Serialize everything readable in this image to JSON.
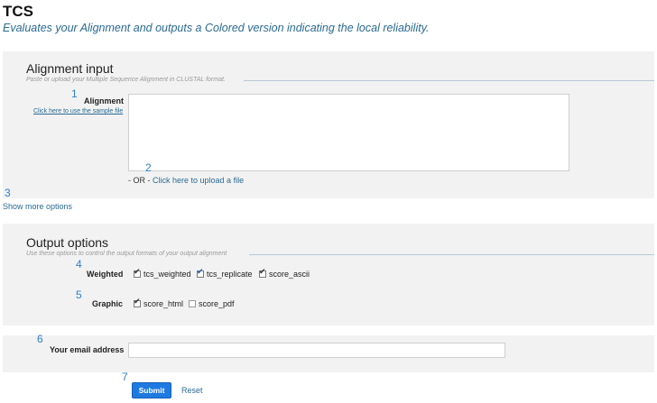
{
  "page": {
    "title": "TCS",
    "subtitle": "Evaluates your Alignment and outputs a Colored version indicating the local reliability."
  },
  "alignment_input": {
    "title": "Alignment input",
    "description": "Paste or upload your Multiple Sequence Alignment in CLUSTAL format.",
    "label": "Alignment",
    "sample_link": "Click here to use the sample file",
    "textarea_value": "",
    "or_text": "- OR -",
    "upload_link": "Click here to upload a file"
  },
  "show_more_options": "Show more options",
  "output_options": {
    "title": "Output options",
    "description": "Use these options to control the output formats of your output alignment",
    "weighted": {
      "label": "Weighted",
      "options": [
        {
          "label": "tcs_weighted",
          "checked": true
        },
        {
          "label": "tcs_replicate",
          "checked": true
        },
        {
          "label": "score_ascii",
          "checked": true
        }
      ]
    },
    "graphic": {
      "label": "Graphic",
      "options": [
        {
          "label": "score_html",
          "checked": true
        },
        {
          "label": "score_pdf",
          "checked": false
        }
      ]
    }
  },
  "email": {
    "label": "Your email address",
    "value": "",
    "placeholder": ""
  },
  "actions": {
    "submit": "Submit",
    "reset": "Reset"
  },
  "callouts": [
    "1",
    "2",
    "3",
    "4",
    "5",
    "6",
    "7"
  ],
  "colors": {
    "link": "#2a6a93",
    "submit_bg": "#1e7ae0",
    "panel_bg": "#f2f2f2",
    "callout": "#2d7fd0"
  }
}
